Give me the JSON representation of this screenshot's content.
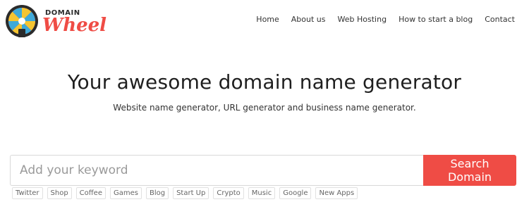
{
  "brand": {
    "small_text": "DOMAIN",
    "big_text": "Wheel",
    "colors": {
      "accent": "#ef4c45",
      "wheel_blue": "#3fa9d8",
      "wheel_yellow": "#f5c531",
      "dark": "#2b2b2b"
    }
  },
  "nav": {
    "items": [
      {
        "label": "Home"
      },
      {
        "label": "About us"
      },
      {
        "label": "Web Hosting"
      },
      {
        "label": "How to start a blog"
      },
      {
        "label": "Contact"
      }
    ]
  },
  "hero": {
    "title": "Your awesome domain name generator",
    "subtitle": "Website name generator, URL generator and business name generator."
  },
  "search": {
    "placeholder": "Add your keyword",
    "value": "",
    "button_label": "Search Domain"
  },
  "tags": [
    "Twitter",
    "Shop",
    "Coffee",
    "Games",
    "Blog",
    "Start Up",
    "Crypto",
    "Music",
    "Google",
    "New Apps"
  ]
}
